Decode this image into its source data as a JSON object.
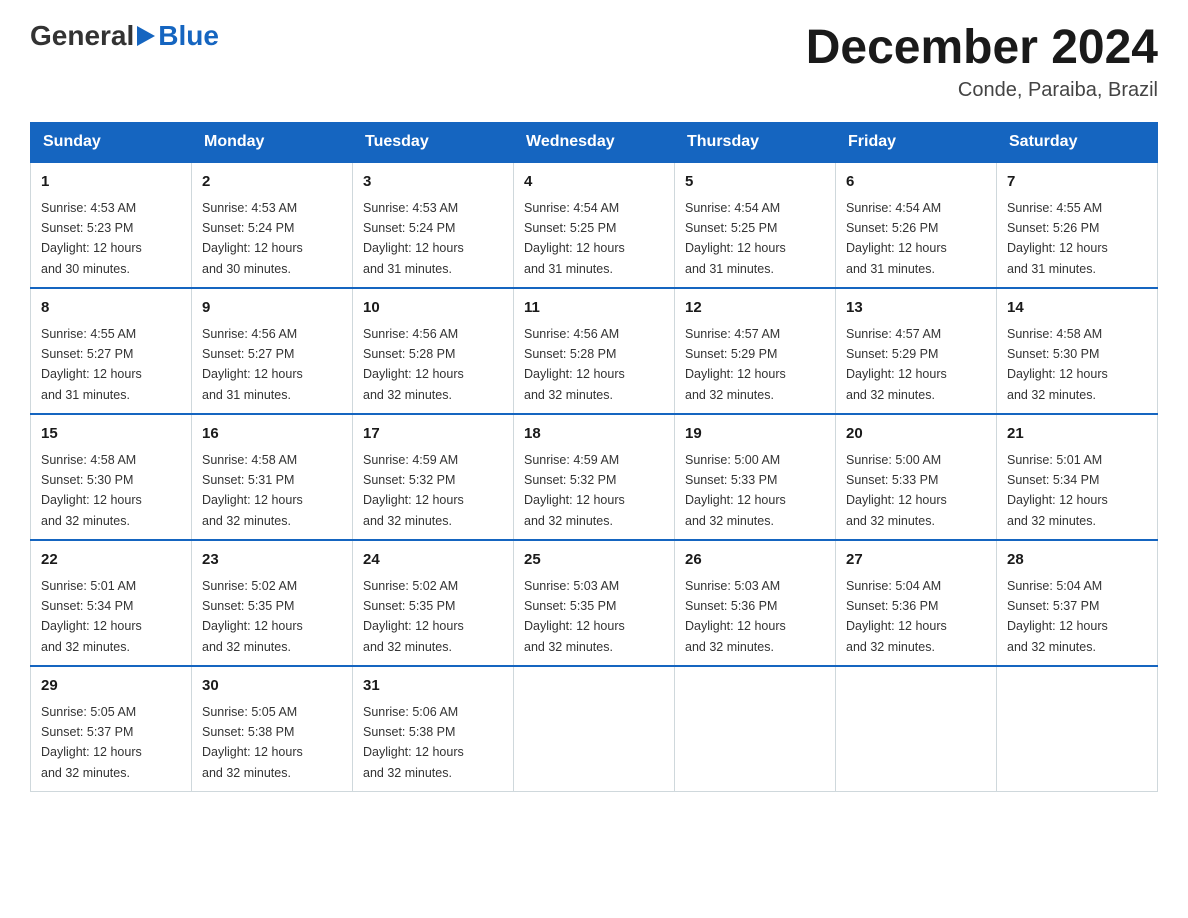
{
  "header": {
    "logo": {
      "general": "General",
      "blue": "Blue"
    },
    "title": "December 2024",
    "location": "Conde, Paraiba, Brazil"
  },
  "days_of_week": [
    "Sunday",
    "Monday",
    "Tuesday",
    "Wednesday",
    "Thursday",
    "Friday",
    "Saturday"
  ],
  "weeks": [
    [
      {
        "day": 1,
        "sunrise": "4:53 AM",
        "sunset": "5:23 PM",
        "daylight": "12 hours and 30 minutes."
      },
      {
        "day": 2,
        "sunrise": "4:53 AM",
        "sunset": "5:24 PM",
        "daylight": "12 hours and 30 minutes."
      },
      {
        "day": 3,
        "sunrise": "4:53 AM",
        "sunset": "5:24 PM",
        "daylight": "12 hours and 31 minutes."
      },
      {
        "day": 4,
        "sunrise": "4:54 AM",
        "sunset": "5:25 PM",
        "daylight": "12 hours and 31 minutes."
      },
      {
        "day": 5,
        "sunrise": "4:54 AM",
        "sunset": "5:25 PM",
        "daylight": "12 hours and 31 minutes."
      },
      {
        "day": 6,
        "sunrise": "4:54 AM",
        "sunset": "5:26 PM",
        "daylight": "12 hours and 31 minutes."
      },
      {
        "day": 7,
        "sunrise": "4:55 AM",
        "sunset": "5:26 PM",
        "daylight": "12 hours and 31 minutes."
      }
    ],
    [
      {
        "day": 8,
        "sunrise": "4:55 AM",
        "sunset": "5:27 PM",
        "daylight": "12 hours and 31 minutes."
      },
      {
        "day": 9,
        "sunrise": "4:56 AM",
        "sunset": "5:27 PM",
        "daylight": "12 hours and 31 minutes."
      },
      {
        "day": 10,
        "sunrise": "4:56 AM",
        "sunset": "5:28 PM",
        "daylight": "12 hours and 32 minutes."
      },
      {
        "day": 11,
        "sunrise": "4:56 AM",
        "sunset": "5:28 PM",
        "daylight": "12 hours and 32 minutes."
      },
      {
        "day": 12,
        "sunrise": "4:57 AM",
        "sunset": "5:29 PM",
        "daylight": "12 hours and 32 minutes."
      },
      {
        "day": 13,
        "sunrise": "4:57 AM",
        "sunset": "5:29 PM",
        "daylight": "12 hours and 32 minutes."
      },
      {
        "day": 14,
        "sunrise": "4:58 AM",
        "sunset": "5:30 PM",
        "daylight": "12 hours and 32 minutes."
      }
    ],
    [
      {
        "day": 15,
        "sunrise": "4:58 AM",
        "sunset": "5:30 PM",
        "daylight": "12 hours and 32 minutes."
      },
      {
        "day": 16,
        "sunrise": "4:58 AM",
        "sunset": "5:31 PM",
        "daylight": "12 hours and 32 minutes."
      },
      {
        "day": 17,
        "sunrise": "4:59 AM",
        "sunset": "5:32 PM",
        "daylight": "12 hours and 32 minutes."
      },
      {
        "day": 18,
        "sunrise": "4:59 AM",
        "sunset": "5:32 PM",
        "daylight": "12 hours and 32 minutes."
      },
      {
        "day": 19,
        "sunrise": "5:00 AM",
        "sunset": "5:33 PM",
        "daylight": "12 hours and 32 minutes."
      },
      {
        "day": 20,
        "sunrise": "5:00 AM",
        "sunset": "5:33 PM",
        "daylight": "12 hours and 32 minutes."
      },
      {
        "day": 21,
        "sunrise": "5:01 AM",
        "sunset": "5:34 PM",
        "daylight": "12 hours and 32 minutes."
      }
    ],
    [
      {
        "day": 22,
        "sunrise": "5:01 AM",
        "sunset": "5:34 PM",
        "daylight": "12 hours and 32 minutes."
      },
      {
        "day": 23,
        "sunrise": "5:02 AM",
        "sunset": "5:35 PM",
        "daylight": "12 hours and 32 minutes."
      },
      {
        "day": 24,
        "sunrise": "5:02 AM",
        "sunset": "5:35 PM",
        "daylight": "12 hours and 32 minutes."
      },
      {
        "day": 25,
        "sunrise": "5:03 AM",
        "sunset": "5:35 PM",
        "daylight": "12 hours and 32 minutes."
      },
      {
        "day": 26,
        "sunrise": "5:03 AM",
        "sunset": "5:36 PM",
        "daylight": "12 hours and 32 minutes."
      },
      {
        "day": 27,
        "sunrise": "5:04 AM",
        "sunset": "5:36 PM",
        "daylight": "12 hours and 32 minutes."
      },
      {
        "day": 28,
        "sunrise": "5:04 AM",
        "sunset": "5:37 PM",
        "daylight": "12 hours and 32 minutes."
      }
    ],
    [
      {
        "day": 29,
        "sunrise": "5:05 AM",
        "sunset": "5:37 PM",
        "daylight": "12 hours and 32 minutes."
      },
      {
        "day": 30,
        "sunrise": "5:05 AM",
        "sunset": "5:38 PM",
        "daylight": "12 hours and 32 minutes."
      },
      {
        "day": 31,
        "sunrise": "5:06 AM",
        "sunset": "5:38 PM",
        "daylight": "12 hours and 32 minutes."
      },
      null,
      null,
      null,
      null
    ]
  ]
}
